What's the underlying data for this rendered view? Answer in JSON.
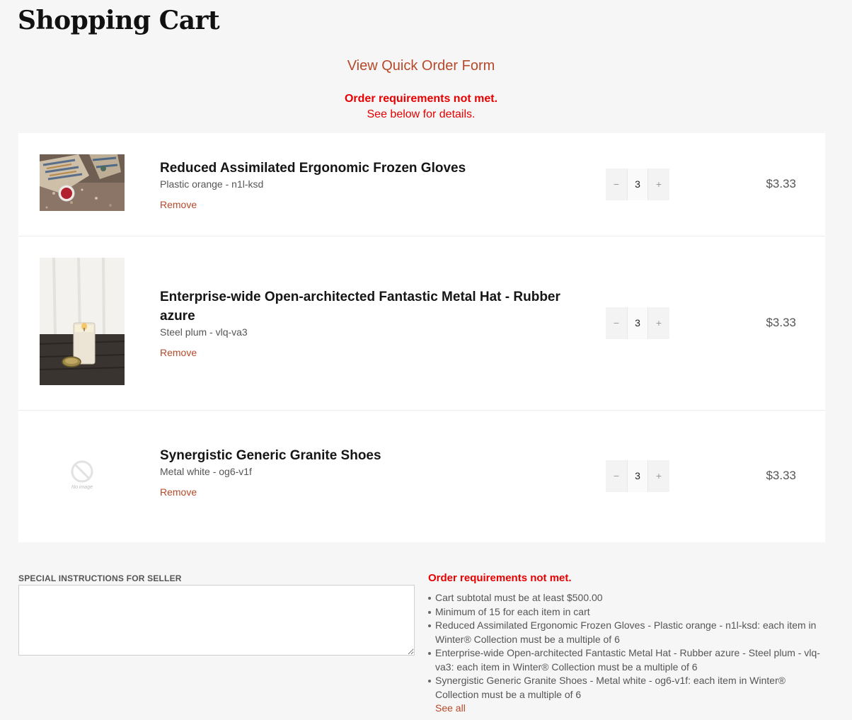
{
  "page": {
    "title": "Shopping Cart"
  },
  "quick_order_link": "View Quick Order Form",
  "top_notice": {
    "title": "Order requirements not met.",
    "subtitle": "See below for details."
  },
  "cart": {
    "items": [
      {
        "title": "Reduced Assimilated Ergonomic Frozen Gloves",
        "variant": "Plastic orange - n1l-ksd",
        "remove": "Remove",
        "qty": "3",
        "price": "$3.33",
        "image": "gloves-photo"
      },
      {
        "title": "Enterprise-wide Open-architected Fantastic Metal Hat - Rubber azure",
        "variant": "Steel plum - vlq-va3",
        "remove": "Remove",
        "qty": "3",
        "price": "$3.33",
        "image": "candle-photo"
      },
      {
        "title": "Synergistic Generic Granite Shoes",
        "variant": "Metal white - og6-v1f",
        "remove": "Remove",
        "qty": "3",
        "price": "$3.33",
        "image": "no-image",
        "no_image_text": "No image"
      }
    ],
    "qty_minus": "−",
    "qty_plus": "+"
  },
  "instructions": {
    "label": "SPECIAL INSTRUCTIONS FOR SELLER",
    "value": ""
  },
  "requirements": {
    "title": "Order requirements not met.",
    "items": [
      "Cart subtotal must be at least $500.00",
      "Minimum of 15 for each item in cart",
      "Reduced Assimilated Ergonomic Frozen Gloves - Plastic orange - n1l-ksd: each item in Winter® Collection must be a multiple of 6",
      "Enterprise-wide Open-architected Fantastic Metal Hat - Rubber azure - Steel plum - vlq-va3: each item in Winter® Collection must be a multiple of 6",
      "Synergistic Generic Granite Shoes - Metal white - og6-v1f: each item in Winter® Collection must be a multiple of 6"
    ],
    "see_all": "See all"
  },
  "colors": {
    "link": "#b6492a",
    "error": "#e60000",
    "background": "#f6f6f6"
  }
}
